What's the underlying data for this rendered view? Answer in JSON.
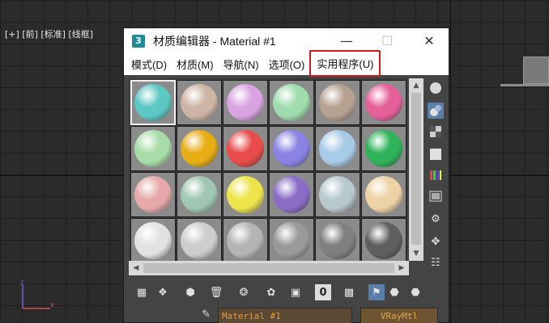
{
  "viewport": {
    "label": "[+] [前] [标准] [线框]"
  },
  "window": {
    "app_icon": "3",
    "title": "材质编辑器 - Material #1",
    "minimize": "—",
    "maximize": "☐",
    "close": "✕"
  },
  "menu": [
    {
      "label": "模式(D)"
    },
    {
      "label": "材质(M)"
    },
    {
      "label": "导航(N)"
    },
    {
      "label": "选项(O)"
    },
    {
      "label": "实用程序(U)",
      "highlighted": true
    }
  ],
  "samples": [
    [
      "#5cc7c3",
      "#cdb4a4",
      "#d8a3e0",
      "#9fdcae",
      "#b7a190",
      "#e5609b"
    ],
    [
      "#a8dca8",
      "#e7ad14",
      "#e74b4b",
      "#8b83e3",
      "#a7cbe6",
      "#2fb25a"
    ],
    [
      "#e6a9a9",
      "#9fc7b3",
      "#ece449",
      "#8b6cc7",
      "#b7c9cf",
      "#ecd2a4"
    ],
    [
      "#e2e2e2",
      "#cdcdcd",
      "#b4b4b4",
      "#9a9a9a",
      "#7f7f7f",
      "#5f5f5f"
    ]
  ],
  "material_name": "Material #1",
  "material_type": "VRayMtl",
  "side_tools": [
    "sphere-icon",
    "cylinder-icon",
    "backlight-icon",
    "checker-icon",
    "color-bars-icon",
    "video-icon",
    "magic-icon",
    "options-icon",
    "select-by-material-icon"
  ],
  "bottom_tools": [
    "get-material-icon",
    "put-to-scene-icon",
    "assign-icon",
    "delete-icon",
    "copy-icon",
    "unique-icon",
    "save-icon",
    "material-id-icon",
    "show-map-icon",
    "show-end-icon",
    "go-parent-icon",
    "go-sibling-icon"
  ]
}
